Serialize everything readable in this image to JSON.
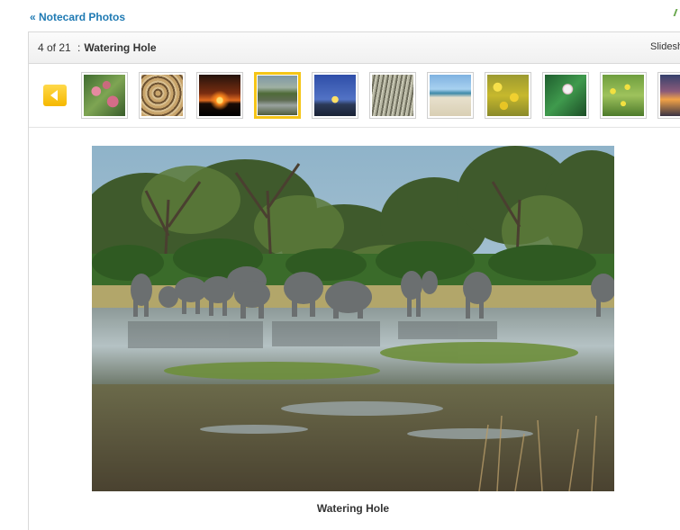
{
  "nav": {
    "back_label": "« Notecard Photos"
  },
  "header": {
    "counter": "4 of 21",
    "separator": ":",
    "title": "Watering Hole",
    "slideshow_label": "Slideshow"
  },
  "thumbnails": [
    {
      "name": "Pink Flowers",
      "selected": false
    },
    {
      "name": "Leopard",
      "selected": false
    },
    {
      "name": "Sunset",
      "selected": false
    },
    {
      "name": "Watering Hole",
      "selected": true
    },
    {
      "name": "Moonrise",
      "selected": false
    },
    {
      "name": "Grasses",
      "selected": false
    },
    {
      "name": "Beach",
      "selected": false
    },
    {
      "name": "Yellow Flowers",
      "selected": false
    },
    {
      "name": "Water Lily",
      "selected": false
    },
    {
      "name": "Wildflowers",
      "selected": false
    },
    {
      "name": "Dusk",
      "selected": false
    }
  ],
  "photo": {
    "caption": "Watering Hole"
  },
  "colors": {
    "link": "#1f7ab3",
    "selected_border": "#f5c518",
    "prev_button": "#f5b800"
  },
  "icons": {
    "prev": "arrow-left-icon"
  }
}
